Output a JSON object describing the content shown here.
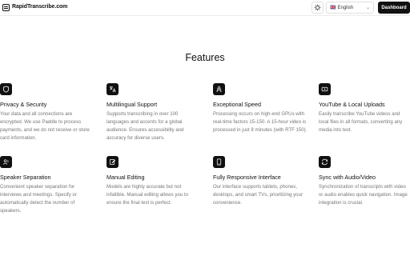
{
  "header": {
    "brand": "RapidTranscribe.com",
    "language": {
      "flag": "🇬🇧",
      "label": "English"
    },
    "dashboard_label": "Dashboard"
  },
  "main": {
    "title": "Features",
    "features": [
      {
        "icon": "shield-icon",
        "title": "Privacy & Security",
        "description": "Your data and all connections are encrypted. We use Paddle to process payments, and we do not receive or store card information."
      },
      {
        "icon": "translate-icon",
        "title": "Multilingual Support",
        "description": "Supports transcribing in over 100 languages and accents for a global audience. Ensures accessibility and accuracy for diverse users."
      },
      {
        "icon": "rocket-icon",
        "title": "Exceptional Speed",
        "description": "Processing occurs on high-end GPUs with real-time factors 15-150. A 15-hour video is processed in just 8 minutes (with RTF 150)."
      },
      {
        "icon": "youtube-icon",
        "title": "YouTube & Local Uploads",
        "description": "Easily transcribe YouTube videos and local files in all formats, converting any media into text."
      },
      {
        "icon": "speaker-icon",
        "title": "Speaker Separation",
        "description": "Convenient speaker separation for interviews and meetings. Specify or automatically detect the number of speakers."
      },
      {
        "icon": "edit-icon",
        "title": "Manual Editing",
        "description": "Models are highly accurate but not infallible. Manual editing allows you to ensure the final text is perfect."
      },
      {
        "icon": "devices-icon",
        "title": "Fully Responsive Interface",
        "description": "Our interface supports tablets, phones, desktops, and smart TVs, prioritizing your convenience."
      },
      {
        "icon": "sync-icon",
        "title": "Sync with Audio/Video",
        "description": "Synchronization of transcripts with video or audio enables quick navigation. Image integration is crucial."
      }
    ]
  }
}
